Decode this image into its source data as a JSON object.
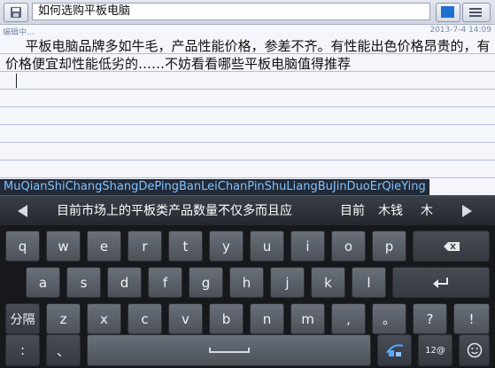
{
  "header": {
    "title_value": "如何选购平板电脑",
    "status_left": "编辑中...",
    "status_right": "2013-7-4 14:09",
    "color_swatch": "#1f6fd1"
  },
  "note": {
    "body": "平板电脑品牌多如牛毛，产品性能价格，参差不齐。有性能出色价格昂贵的，有价格便宜却性能低劣的……不妨看看哪些平板电脑值得推荐"
  },
  "ime": {
    "composing": "MuQianShiChangShangDePingBanLeiChanPinShuLiangBuJinDuoErQieYing",
    "candidates": [
      "目前市场上的平板类产品数量不仅多而且应",
      "目前",
      "木钱",
      "木"
    ],
    "row1": [
      "q",
      "w",
      "e",
      "r",
      "t",
      "y",
      "u",
      "i",
      "o",
      "p"
    ],
    "row2": [
      "a",
      "s",
      "d",
      "f",
      "g",
      "h",
      "j",
      "k",
      "l"
    ],
    "row3_left": "分隔",
    "row3": [
      "z",
      "x",
      "c",
      "v",
      "b",
      "n",
      "m"
    ],
    "row3_punct": [
      ",",
      "。",
      "?",
      "!"
    ],
    "row4": {
      "colon": ":",
      "comma": "、",
      "lang": "12@"
    }
  }
}
